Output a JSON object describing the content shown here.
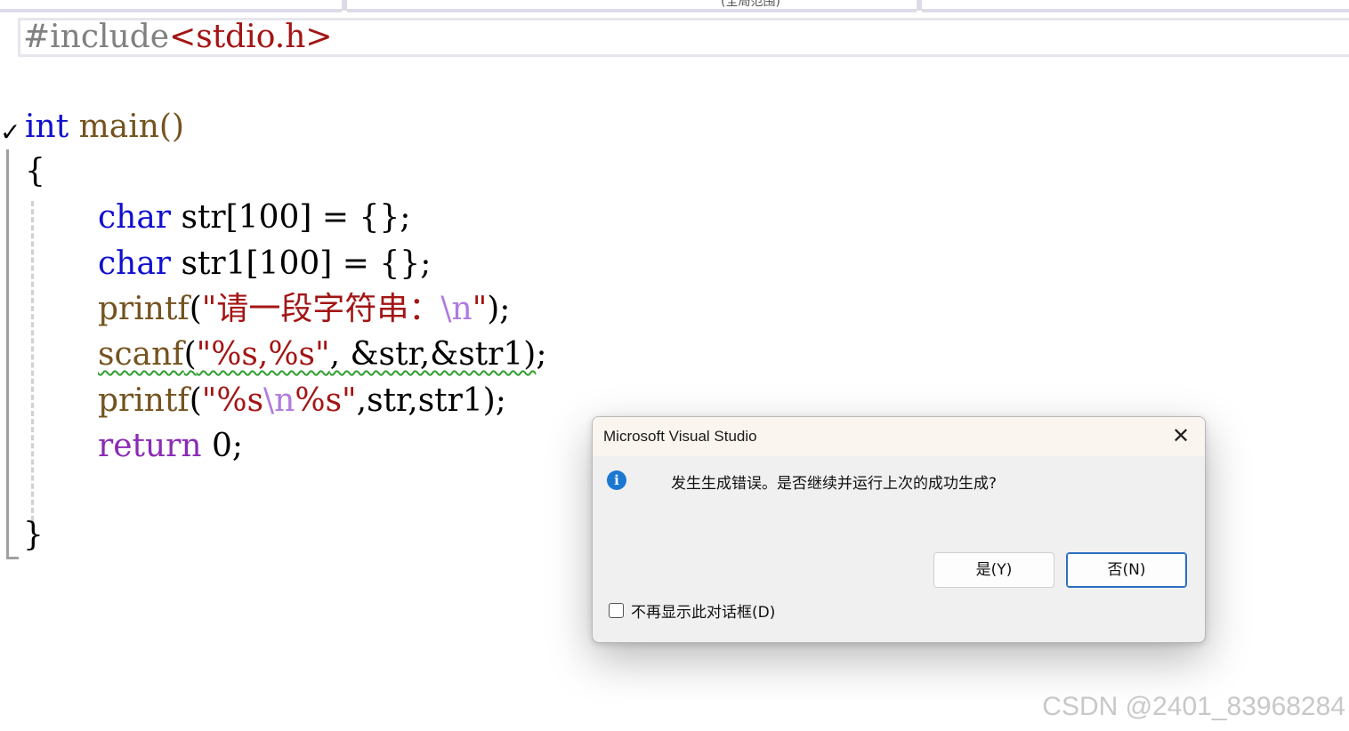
{
  "navbar": {
    "cut_text": "(全局范围)"
  },
  "editor": {
    "lines": {
      "l0": {
        "directive": "#include",
        "header": "<stdio.h>"
      },
      "l2": {
        "type": "int",
        "name": " main()"
      },
      "l3": {
        "text": "{"
      },
      "l4": {
        "type": "char",
        "rest": " str[100] = {};"
      },
      "l5": {
        "type": "char",
        "rest": " str1[100] = {};"
      },
      "l6": {
        "fn": "printf",
        "open": "(",
        "str": "\"请一段字符串：",
        "esc": "\\n",
        "strend": "\"",
        "close": ");"
      },
      "l7": {
        "fn": "scanf",
        "open": "(",
        "str": "\"%s,%s\"",
        "args": ", &str,&str1)",
        "end": ";"
      },
      "l8": {
        "fn": "printf",
        "open": "(",
        "str1": "\"%s",
        "esc": "\\n",
        "str2": "%s\"",
        "rest": ",str,str1);"
      },
      "l9": {
        "kw": "return",
        "rest": " 0;"
      },
      "l11": {
        "text": "}"
      }
    },
    "collapse_glyph": "✓"
  },
  "dialog": {
    "title": "Microsoft Visual Studio",
    "close_glyph": "✕",
    "icon": "info-icon",
    "message": "发生生成错误。是否继续并运行上次的成功生成?",
    "yes_label": "是(Y)",
    "no_label": "否(N)",
    "checkbox_label": "不再显示此对话框(D)",
    "checkbox_checked": false
  },
  "watermark": "CSDN @2401_83968284"
}
